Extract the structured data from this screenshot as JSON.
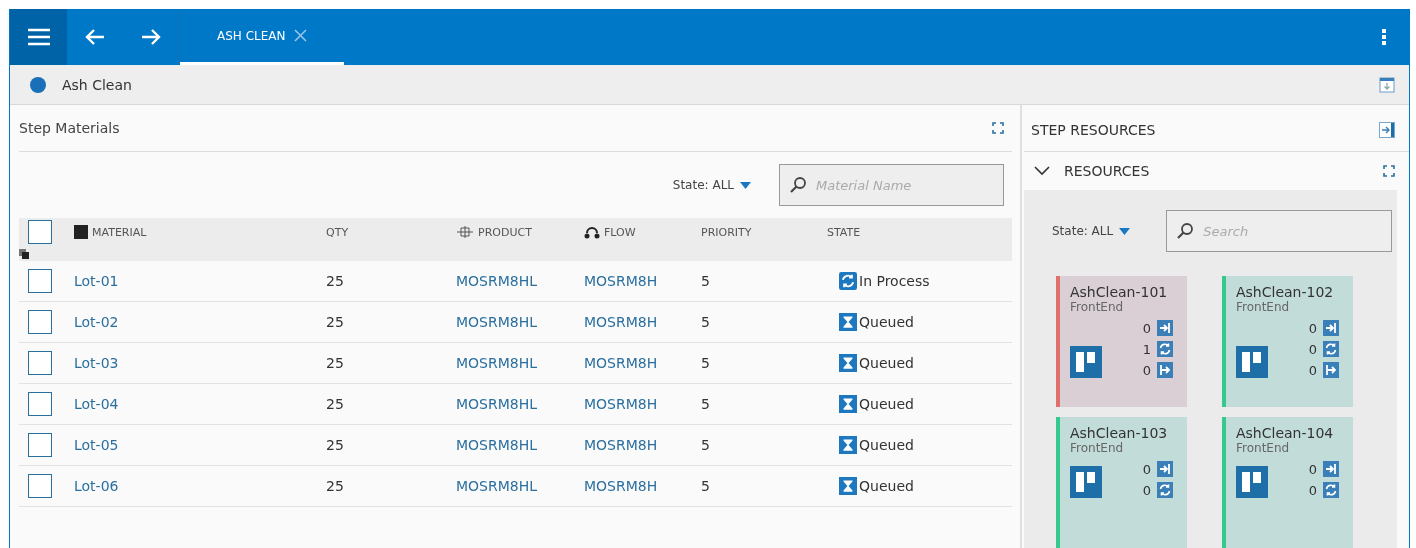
{
  "top_bar": {
    "tabs": [
      {
        "label": "ASH CLEAN",
        "selected": true
      }
    ]
  },
  "page_header": {
    "title": "Ash Clean"
  },
  "step_materials": {
    "title": "Step Materials",
    "state_filter": "State: ALL",
    "search": {
      "placeholder": "Material Name"
    },
    "columns": [
      "MATERIAL",
      "QTY",
      "PRODUCT",
      "FLOW",
      "PRIORITY",
      "STATE"
    ],
    "header_checked": false,
    "rows": [
      {
        "material": "Lot-01",
        "qty": "25",
        "product": "MOSRM8HL",
        "flow": "MOSRM8H",
        "priority": "5",
        "state": "In Process",
        "kind": "process",
        "checked": false
      },
      {
        "material": "Lot-02",
        "qty": "25",
        "product": "MOSRM8HL",
        "flow": "MOSRM8H",
        "priority": "5",
        "state": "Queued",
        "kind": "queued",
        "checked": false
      },
      {
        "material": "Lot-03",
        "qty": "25",
        "product": "MOSRM8HL",
        "flow": "MOSRM8H",
        "priority": "5",
        "state": "Queued",
        "kind": "queued",
        "checked": false
      },
      {
        "material": "Lot-04",
        "qty": "25",
        "product": "MOSRM8HL",
        "flow": "MOSRM8H",
        "priority": "5",
        "state": "Queued",
        "kind": "queued",
        "checked": false
      },
      {
        "material": "Lot-05",
        "qty": "25",
        "product": "MOSRM8HL",
        "flow": "MOSRM8H",
        "priority": "5",
        "state": "Queued",
        "kind": "queued",
        "checked": false
      },
      {
        "material": "Lot-06",
        "qty": "25",
        "product": "MOSRM8HL",
        "flow": "MOSRM8H",
        "priority": "5",
        "state": "Queued",
        "kind": "queued",
        "checked": false
      }
    ]
  },
  "step_resources": {
    "title": "STEP RESOURCES",
    "section": {
      "title": "RESOURCES",
      "expanded": true
    },
    "state_filter": "State: ALL",
    "search": {
      "placeholder": "Search"
    },
    "cards": [
      {
        "name": "AshClean-101",
        "area": "FrontEnd",
        "color": "#e0706c",
        "counters": [
          {
            "kind": "in",
            "value": "0"
          },
          {
            "kind": "process",
            "value": "1"
          },
          {
            "kind": "out",
            "value": "0"
          }
        ]
      },
      {
        "name": "AshClean-102",
        "area": "FrontEnd",
        "color": "#35c98e",
        "counters": [
          {
            "kind": "in",
            "value": "0"
          },
          {
            "kind": "process",
            "value": "0"
          },
          {
            "kind": "out",
            "value": "0"
          }
        ]
      },
      {
        "name": "AshClean-103",
        "area": "FrontEnd",
        "color": "#35c98e",
        "counters": [
          {
            "kind": "in",
            "value": "0"
          },
          {
            "kind": "process",
            "value": "0"
          }
        ]
      },
      {
        "name": "AshClean-104",
        "area": "FrontEnd",
        "color": "#35c98e",
        "counters": [
          {
            "kind": "in",
            "value": "0"
          },
          {
            "kind": "process",
            "value": "0"
          }
        ]
      }
    ]
  }
}
